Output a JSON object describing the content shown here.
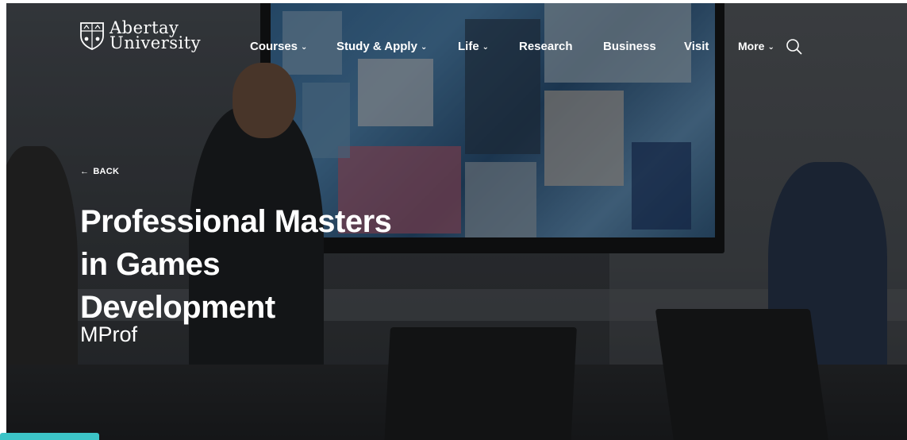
{
  "brand": {
    "name_line1": "Abertay",
    "name_line2": "University",
    "logo_icon": "crest-icon"
  },
  "nav": {
    "items": [
      {
        "label": "Courses",
        "has_dropdown": true
      },
      {
        "label": "Study & Apply",
        "has_dropdown": true
      },
      {
        "label": "Life",
        "has_dropdown": true
      },
      {
        "label": "Research",
        "has_dropdown": false
      },
      {
        "label": "Business",
        "has_dropdown": false
      },
      {
        "label": "Visit",
        "has_dropdown": false
      },
      {
        "label": "More",
        "has_dropdown": true
      }
    ],
    "search_icon": "search-icon"
  },
  "hero": {
    "back_label": "BACK",
    "title_lines": [
      "Professional Masters",
      "in Games",
      "Development"
    ],
    "subtitle": "MProf"
  },
  "colors": {
    "accent": "#3cc4c7",
    "text": "#ffffff"
  }
}
